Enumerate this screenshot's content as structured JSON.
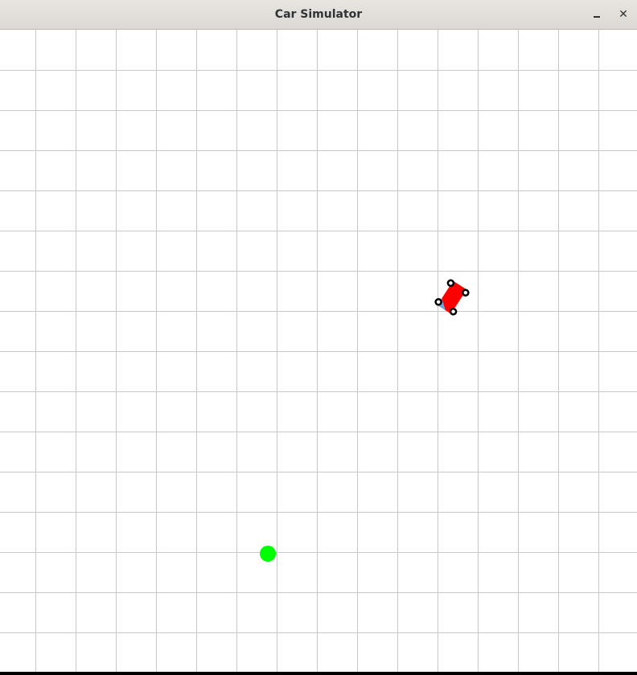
{
  "window": {
    "title": "Car Simulator",
    "minimize_icon": "minimize-icon",
    "close_label": "✕"
  },
  "scene": {
    "background": "#ffffff",
    "grid_color": "#c8c8c8",
    "car": {
      "body_color": "#ff0000",
      "windshield_color": "#6fa8dc",
      "wheel_color": "#000000"
    },
    "target": {
      "color": "#00ff00"
    }
  }
}
